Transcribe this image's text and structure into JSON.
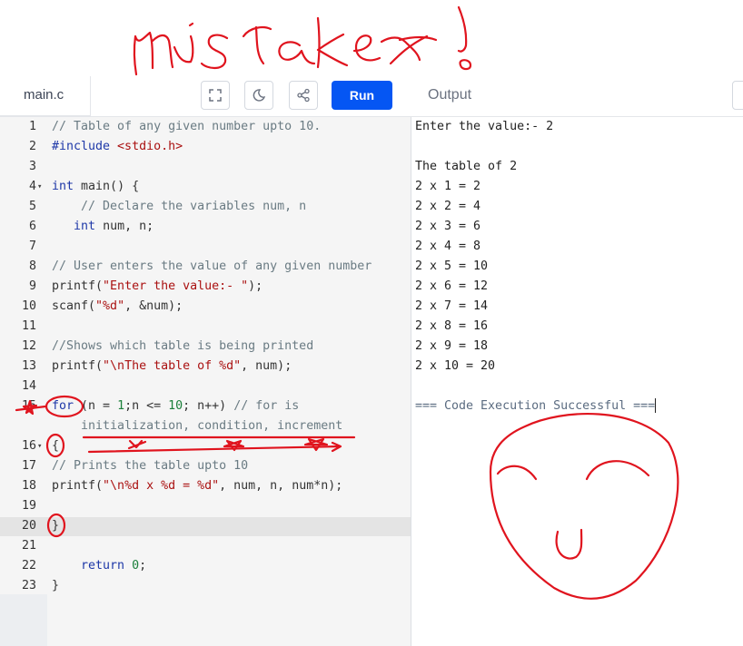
{
  "toolbar": {
    "file_tab": "main.c",
    "run_label": "Run",
    "output_label": "Output"
  },
  "icons": [
    "fullscreen-icon",
    "moon-icon",
    "share-icon"
  ],
  "colors": {
    "run_button": "#0556f3",
    "annotation": "#e0141e"
  },
  "editor": {
    "lines": [
      {
        "n": "1",
        "parts": [
          {
            "t": "// Table of any given number upto 10.",
            "c": "comment"
          }
        ]
      },
      {
        "n": "2",
        "parts": [
          {
            "t": "#include",
            "c": "key"
          },
          {
            "t": " <stdio.h>",
            "c": "str"
          }
        ]
      },
      {
        "n": "3",
        "parts": []
      },
      {
        "n": "4",
        "fold": true,
        "parts": [
          {
            "t": "int",
            "c": "type"
          },
          {
            "t": " main() {",
            "c": "plain"
          }
        ]
      },
      {
        "n": "5",
        "parts": [
          {
            "t": "    // Declare the variables num, n",
            "c": "comment"
          }
        ]
      },
      {
        "n": "6",
        "parts": [
          {
            "t": "   ",
            "c": "plain"
          },
          {
            "t": "int",
            "c": "type"
          },
          {
            "t": " num, n;",
            "c": "plain"
          }
        ]
      },
      {
        "n": "7",
        "parts": []
      },
      {
        "n": "8",
        "parts": [
          {
            "t": "// User enters the value of any given number",
            "c": "comment"
          }
        ]
      },
      {
        "n": "9",
        "parts": [
          {
            "t": "printf(",
            "c": "plain"
          },
          {
            "t": "\"Enter the value:- \"",
            "c": "str"
          },
          {
            "t": ");",
            "c": "plain"
          }
        ]
      },
      {
        "n": "10",
        "parts": [
          {
            "t": "scanf(",
            "c": "plain"
          },
          {
            "t": "\"%d\"",
            "c": "str"
          },
          {
            "t": ", &num);",
            "c": "plain"
          }
        ]
      },
      {
        "n": "11",
        "parts": []
      },
      {
        "n": "12",
        "parts": [
          {
            "t": "//Shows which table is being printed",
            "c": "comment"
          }
        ]
      },
      {
        "n": "13",
        "parts": [
          {
            "t": "printf(",
            "c": "plain"
          },
          {
            "t": "\"\\nThe table of %d\"",
            "c": "str"
          },
          {
            "t": ", num);",
            "c": "plain"
          }
        ]
      },
      {
        "n": "14",
        "parts": []
      },
      {
        "n": "15",
        "parts": [
          {
            "t": "for",
            "c": "key"
          },
          {
            "t": " (n = ",
            "c": "plain"
          },
          {
            "t": "1",
            "c": "num"
          },
          {
            "t": ";n <= ",
            "c": "plain"
          },
          {
            "t": "10",
            "c": "num"
          },
          {
            "t": "; n++) ",
            "c": "plain"
          },
          {
            "t": "// for is",
            "c": "comment"
          }
        ]
      },
      {
        "n": "",
        "parts": [
          {
            "t": "    initialization, condition, increment",
            "c": "comment"
          }
        ]
      },
      {
        "n": "16",
        "fold": true,
        "parts": [
          {
            "t": "{",
            "c": "plain"
          }
        ]
      },
      {
        "n": "17",
        "parts": [
          {
            "t": "// Prints the table upto 10",
            "c": "comment"
          }
        ]
      },
      {
        "n": "18",
        "parts": [
          {
            "t": "printf(",
            "c": "plain"
          },
          {
            "t": "\"\\n%d x %d = %d\"",
            "c": "str"
          },
          {
            "t": ", num, n, num*n);",
            "c": "plain"
          }
        ]
      },
      {
        "n": "19",
        "parts": []
      },
      {
        "n": "20",
        "parts": [
          {
            "t": "}",
            "c": "plain"
          }
        ]
      },
      {
        "n": "21",
        "parts": []
      },
      {
        "n": "22",
        "parts": [
          {
            "t": "    return ",
            "c": "key"
          },
          {
            "t": "0",
            "c": "num"
          },
          {
            "t": ";",
            "c": "plain"
          }
        ]
      },
      {
        "n": "23",
        "parts": [
          {
            "t": "}",
            "c": "plain"
          }
        ]
      }
    ]
  },
  "output": {
    "lines": [
      "Enter the value:- 2",
      "",
      "The table of 2",
      "2 x 1 = 2",
      "2 x 2 = 4",
      "2 x 3 = 6",
      "2 x 4 = 8",
      "2 x 5 = 10",
      "2 x 6 = 12",
      "2 x 7 = 14",
      "2 x 8 = 16",
      "2 x 9 = 18",
      "2 x 10 = 20",
      "",
      ""
    ],
    "success": "=== Code Execution Successful ==="
  },
  "annotation": {
    "heading": "mistake!"
  }
}
